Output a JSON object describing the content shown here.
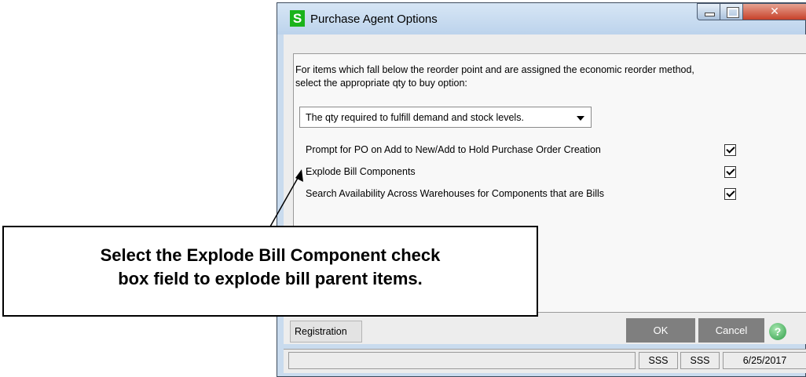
{
  "window": {
    "title": "Purchase Agent Options",
    "app_icon_letter": "S"
  },
  "options": {
    "intro_text": "For items which fall below the reorder point and are assigned the economic reorder method,\nselect the appropriate qty to buy option:",
    "qty_option_selected": "The qty required to fulfill demand and stock levels.",
    "checkboxes": [
      {
        "label": "Prompt for PO on Add to New/Add to Hold Purchase Order Creation",
        "checked": true
      },
      {
        "label": "Explode Bill Components",
        "checked": true
      },
      {
        "label": "Search Availability Across Warehouses for Components that are Bills",
        "checked": true
      }
    ]
  },
  "footer": {
    "registration_label": "Registration",
    "ok_label": "OK",
    "cancel_label": "Cancel"
  },
  "statusbar": {
    "user": "SSS",
    "company": "SSS",
    "date": "6/25/2017"
  },
  "callout": {
    "text": "Select the Explode Bill Component check\nbox field to explode bill parent items."
  },
  "colors": {
    "button_gray": "#7f7f7f",
    "app_icon_green": "#1bb31b",
    "close_red": "#c7412a"
  }
}
